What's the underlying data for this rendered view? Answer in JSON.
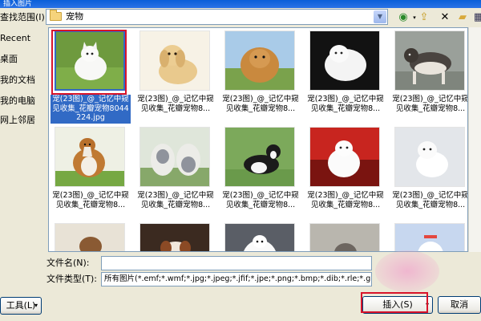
{
  "window": {
    "title": "插入图片"
  },
  "look_in": {
    "label": "查找范围(I):",
    "path": "宠物"
  },
  "toolbar": {
    "back_icon": "back-icon",
    "up_icon": "up-folder-icon",
    "delete_icon": "delete-icon",
    "new_folder_icon": "new-folder-icon",
    "views_icon": "views-menu-icon"
  },
  "places": [
    {
      "label": "Recent"
    },
    {
      "label": "桌面"
    },
    {
      "label": "我的文档"
    },
    {
      "label": "我的电脑"
    },
    {
      "label": "网上邻居"
    }
  ],
  "files": [
    {
      "caption": "宠(23图)_@_记忆中窥见收集_花瓣宠物8044224.jpg",
      "selected": true
    },
    {
      "caption": "宠(23图)_@_记忆中窥见收集_花瓣宠物8...",
      "selected": false
    },
    {
      "caption": "宠(23图)_@_记忆中窥见收集_花瓣宠物8...",
      "selected": false
    },
    {
      "caption": "宠(23图)_@_记忆中窥见收集_花瓣宠物8...",
      "selected": false
    },
    {
      "caption": "宠(23图)_@_记忆中窥见收集_花瓣宠物8...",
      "selected": false
    },
    {
      "caption": "宠(23图)_@_记忆中窥见收集_花瓣宠物8...",
      "selected": false
    },
    {
      "caption": "宠(23图)_@_记忆中窥见收集_花瓣宠物8...",
      "selected": false
    },
    {
      "caption": "宠(23图)_@_记忆中窥见收集_花瓣宠物8...",
      "selected": false
    },
    {
      "caption": "宠(23图)_@_记忆中窥见收集_花瓣宠物8...",
      "selected": false
    },
    {
      "caption": "宠(23图)_@_记忆中窥见收集_花瓣宠物8...",
      "selected": false
    },
    {
      "caption": "",
      "selected": false
    },
    {
      "caption": "",
      "selected": false
    },
    {
      "caption": "",
      "selected": false
    },
    {
      "caption": "",
      "selected": false
    },
    {
      "caption": "",
      "selected": false
    }
  ],
  "filename": {
    "label": "文件名(N):",
    "value": ""
  },
  "filetype": {
    "label": "文件类型(T):",
    "value": "所有图片(*.emf;*.wmf;*.jpg;*.jpeg;*.jfif;*.jpe;*.png;*.bmp;*.dib;*.rle;*.gif"
  },
  "buttons": {
    "tools": "工具(L)",
    "insert": "插入(S)",
    "cancel": "取消"
  },
  "colors": {
    "selection": "#316ac5",
    "highlight": "#d8142a",
    "title_bar": "#0a5fd8"
  }
}
